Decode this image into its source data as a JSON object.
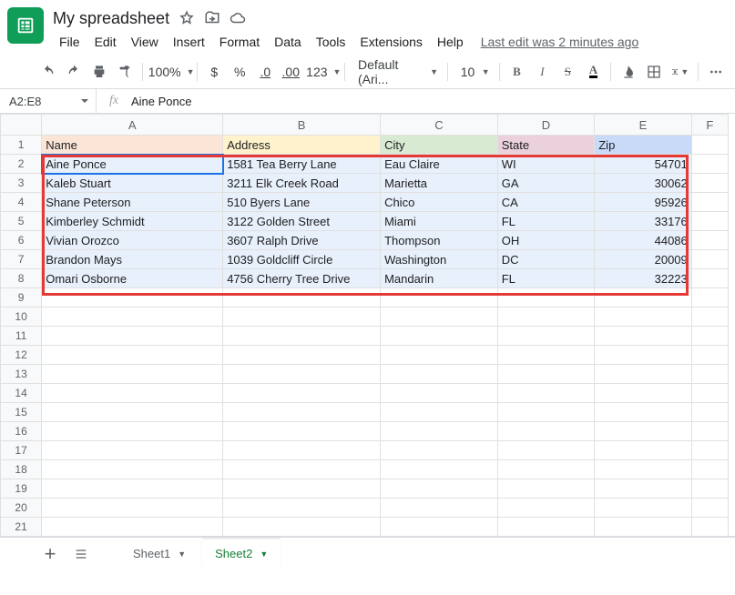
{
  "header": {
    "title": "My spreadsheet",
    "last_edit": "Last edit was 2 minutes ago"
  },
  "menus": [
    "File",
    "Edit",
    "View",
    "Insert",
    "Format",
    "Data",
    "Tools",
    "Extensions",
    "Help"
  ],
  "toolbar": {
    "zoom": "100%",
    "font": "Default (Ari...",
    "font_size": "10",
    "decimal_dec": ".0",
    "decimal_inc": ".00",
    "num_fmt": "123",
    "bold": "B",
    "italic": "I",
    "strike": "S",
    "text_color": "A"
  },
  "formula": {
    "name_box": "A2:E8",
    "fx": "fx",
    "value": "Aine Ponce"
  },
  "columns": [
    "A",
    "B",
    "C",
    "D",
    "E",
    "F"
  ],
  "row_count": 21,
  "headers": {
    "name": "Name",
    "address": "Address",
    "city": "City",
    "state": "State",
    "zip": "Zip"
  },
  "rows": [
    {
      "name": "Aine Ponce",
      "address": "1581 Tea Berry Lane",
      "city": "Eau Claire",
      "state": "WI",
      "zip": "54701"
    },
    {
      "name": "Kaleb Stuart",
      "address": "3211 Elk Creek Road",
      "city": "Marietta",
      "state": "GA",
      "zip": "30062"
    },
    {
      "name": "Shane Peterson",
      "address": "510 Byers Lane",
      "city": "Chico",
      "state": "CA",
      "zip": "95926"
    },
    {
      "name": "Kimberley Schmidt",
      "address": "3122 Golden Street",
      "city": "Miami",
      "state": "FL",
      "zip": "33176"
    },
    {
      "name": "Vivian Orozco",
      "address": "3607 Ralph Drive",
      "city": "Thompson",
      "state": "OH",
      "zip": "44086"
    },
    {
      "name": "Brandon Mays",
      "address": "1039 Goldcliff Circle",
      "city": "Washington",
      "state": "DC",
      "zip": "20009"
    },
    {
      "name": "Omari Osborne",
      "address": "4756 Cherry Tree Drive",
      "city": "Mandarin",
      "state": "FL",
      "zip": "32223"
    }
  ],
  "tabs": {
    "sheet1": "Sheet1",
    "sheet2": "Sheet2"
  }
}
